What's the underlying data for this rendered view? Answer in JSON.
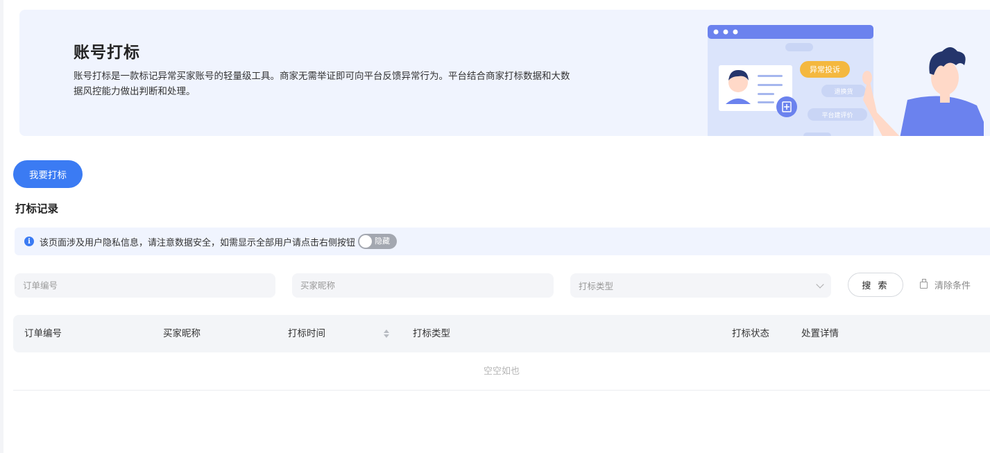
{
  "banner": {
    "title": "账号打标",
    "description": "账号打标是一款标记异常买家账号的轻量级工具。商家无需举证即可向平台反馈异常行为。平台结合商家打标数据和大数据风控能力做出判断和处理。",
    "illustration": {
      "complaint_tag": "异常投诉",
      "tag_2": "退换货",
      "tag_3": "平台建评价",
      "accent_color": "#6b82ee",
      "tag_color": "#f4b83f"
    }
  },
  "actions": {
    "mark_button": "我要打标"
  },
  "records": {
    "title": "打标记录"
  },
  "notice": {
    "text": "该页面涉及用户隐私信息，请注意数据安全，如需显示全部用户请点击右侧按钮",
    "toggle_label": "隐藏"
  },
  "filters": {
    "order_placeholder": "订单编号",
    "buyer_placeholder": "买家昵称",
    "type_placeholder": "打标类型",
    "search_button": "搜 索",
    "clear_button": "清除条件"
  },
  "table": {
    "columns": [
      "订单编号",
      "买家昵称",
      "打标时间",
      "打标类型",
      "打标状态",
      "处置详情"
    ],
    "empty_text": "空空如也"
  },
  "colors": {
    "primary": "#3b7bf3",
    "banner_bg": "#f0f4fe"
  }
}
